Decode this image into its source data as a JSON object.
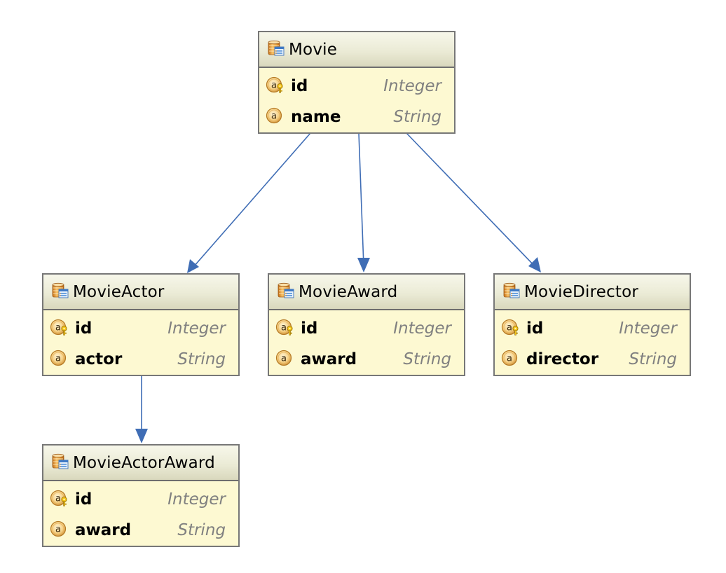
{
  "diagram": {
    "type": "entity-relationship",
    "colors": {
      "connector": "#3f6db5",
      "entity_fill": "#fdf9d2",
      "entity_border": "#777777",
      "type_text": "#808080"
    },
    "entities": [
      {
        "id": "movie",
        "name": "Movie",
        "icon": "table-icon",
        "attributes": [
          {
            "name": "id",
            "type": "Integer",
            "icon": "primary-key-attribute-icon",
            "primary_key": true
          },
          {
            "name": "name",
            "type": "String",
            "icon": "attribute-icon",
            "primary_key": false
          }
        ]
      },
      {
        "id": "movie-actor",
        "name": "MovieActor",
        "icon": "table-icon",
        "attributes": [
          {
            "name": "id",
            "type": "Integer",
            "icon": "primary-key-attribute-icon",
            "primary_key": true
          },
          {
            "name": "actor",
            "type": "String",
            "icon": "attribute-icon",
            "primary_key": false
          }
        ]
      },
      {
        "id": "movie-award",
        "name": "MovieAward",
        "icon": "table-icon",
        "attributes": [
          {
            "name": "id",
            "type": "Integer",
            "icon": "primary-key-attribute-icon",
            "primary_key": true
          },
          {
            "name": "award",
            "type": "String",
            "icon": "attribute-icon",
            "primary_key": false
          }
        ]
      },
      {
        "id": "movie-director",
        "name": "MovieDirector",
        "icon": "table-icon",
        "attributes": [
          {
            "name": "id",
            "type": "Integer",
            "icon": "primary-key-attribute-icon",
            "primary_key": true
          },
          {
            "name": "director",
            "type": "String",
            "icon": "attribute-icon",
            "primary_key": false
          }
        ]
      },
      {
        "id": "movie-actor-award",
        "name": "MovieActorAward",
        "icon": "table-icon",
        "attributes": [
          {
            "name": "id",
            "type": "Integer",
            "icon": "primary-key-attribute-icon",
            "primary_key": true
          },
          {
            "name": "award",
            "type": "String",
            "icon": "attribute-icon",
            "primary_key": false
          }
        ]
      }
    ],
    "relationships": [
      {
        "from": "Movie",
        "to": "MovieActor",
        "arrow": "to"
      },
      {
        "from": "Movie",
        "to": "MovieAward",
        "arrow": "to"
      },
      {
        "from": "Movie",
        "to": "MovieDirector",
        "arrow": "to"
      },
      {
        "from": "MovieActor",
        "to": "MovieActorAward",
        "arrow": "to"
      }
    ]
  }
}
